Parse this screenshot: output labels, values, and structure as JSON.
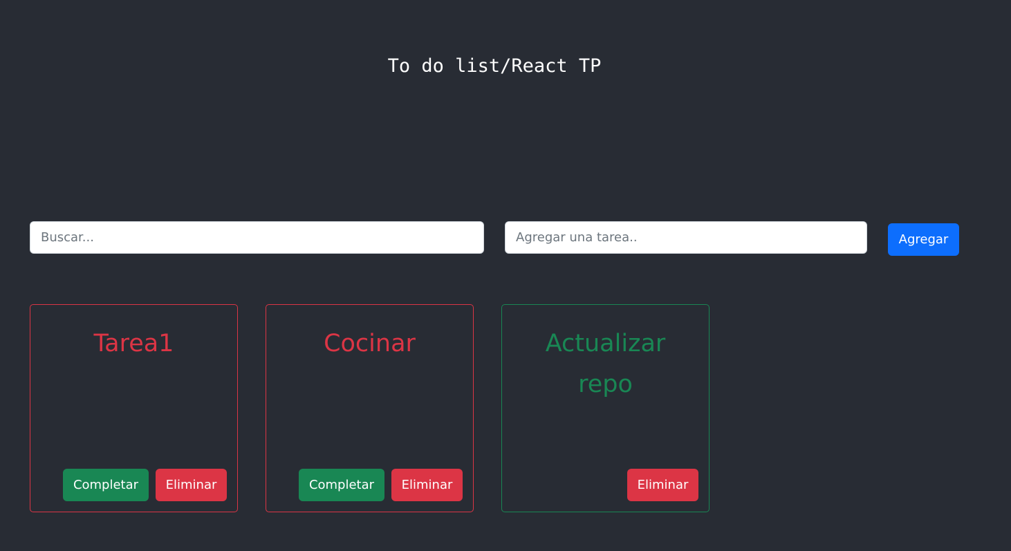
{
  "header": {
    "title": "To do list/React TP"
  },
  "search": {
    "placeholder": "Buscar..."
  },
  "new_task": {
    "placeholder": "Agregar una tarea..",
    "add_label": "Agregar"
  },
  "tasks": [
    {
      "title": "Tarea1",
      "completed": false,
      "complete_label": "Completar",
      "delete_label": "Eliminar"
    },
    {
      "title": "Cocinar",
      "completed": false,
      "complete_label": "Completar",
      "delete_label": "Eliminar"
    },
    {
      "title": "Actualizar repo",
      "completed": true,
      "delete_label": "Eliminar"
    }
  ],
  "colors": {
    "background": "#282c34",
    "primary": "#0d6efd",
    "success": "#198754",
    "danger": "#dc3545",
    "pending_task": "#dc3545",
    "completed_task": "#198754"
  }
}
